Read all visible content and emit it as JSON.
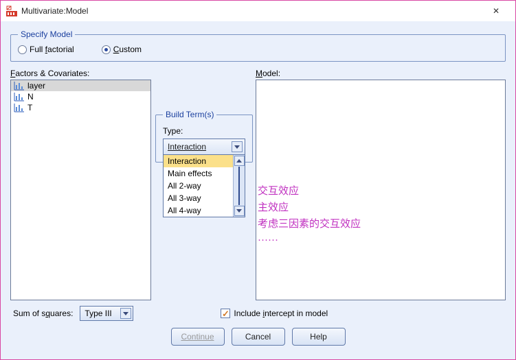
{
  "window": {
    "title": "Multivariate:Model",
    "close_label": "✕"
  },
  "specify": {
    "legend": "Specify Model",
    "full_text_prefix": "Full ",
    "full_underline": "f",
    "full_text_suffix": "actorial",
    "custom_underline": "C",
    "custom_text_suffix": "ustom"
  },
  "factors": {
    "underline": "F",
    "label_suffix": "actors & Covariates:",
    "items": [
      {
        "name": "layer",
        "selected": true
      },
      {
        "name": "N",
        "selected": false
      },
      {
        "name": "T",
        "selected": false
      }
    ]
  },
  "build": {
    "legend": "Build Term(s)",
    "type_label": "Type:",
    "selected": "Interaction",
    "options": [
      "Interaction",
      "Main effects",
      "All 2-way",
      "All 3-way",
      "All 4-way"
    ]
  },
  "model": {
    "underline": "M",
    "label_suffix": "odel:"
  },
  "annotations": {
    "line1": "交互效应",
    "line2": "主效应",
    "line3": "考虑三因素的交互效应",
    "line4": "······"
  },
  "sos": {
    "label_prefix": "Sum of s",
    "underline": "q",
    "label_suffix": "uares:",
    "value": "Type III"
  },
  "intercept": {
    "label_prefix": "Include ",
    "underline": "i",
    "label_suffix": "ntercept in model",
    "checked": true
  },
  "buttons": {
    "continue": "Continue",
    "cancel": "Cancel",
    "help": "Help"
  }
}
